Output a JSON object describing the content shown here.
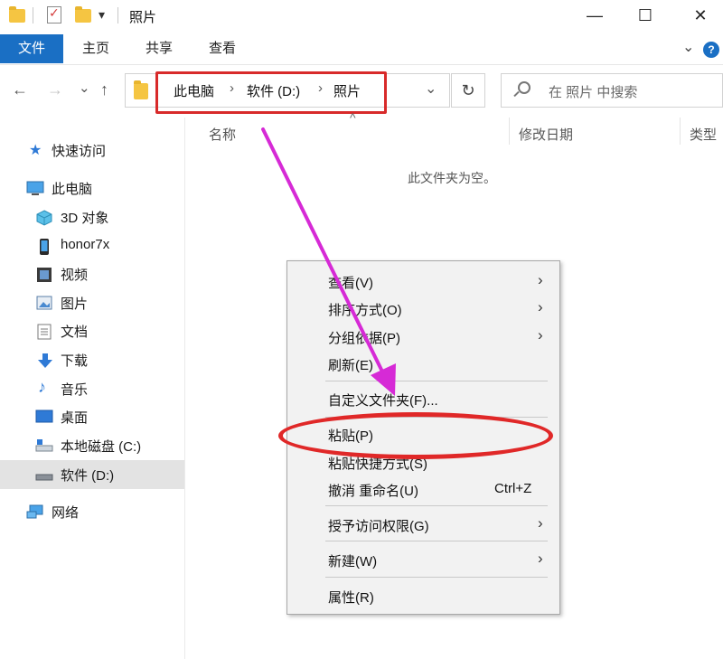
{
  "window": {
    "title": "照片",
    "qat_dropdown": "▾",
    "minimize": "—",
    "maximize": "☐",
    "close": "✕"
  },
  "ribbon": {
    "tabs": [
      "文件",
      "主页",
      "共享",
      "查看"
    ],
    "expand": "⌄",
    "help": "?"
  },
  "nav": {
    "back": "←",
    "forward": "→",
    "recent": "⌄",
    "up": "↑",
    "breadcrumb": [
      "此电脑",
      "软件 (D:)",
      "照片"
    ],
    "crumb_separator": "›",
    "dropdown": "⌄",
    "refresh": "↻",
    "search_placeholder": "在 照片 中搜索"
  },
  "sidebar": {
    "items": [
      {
        "label": "快速访问",
        "icon": "star-icon"
      },
      {
        "label": "此电脑",
        "icon": "computer-icon"
      },
      {
        "label": "3D 对象",
        "icon": "cube-icon"
      },
      {
        "label": "honor7x",
        "icon": "phone-icon"
      },
      {
        "label": "视频",
        "icon": "film-icon"
      },
      {
        "label": "图片",
        "icon": "picture-icon"
      },
      {
        "label": "文档",
        "icon": "document-icon"
      },
      {
        "label": "下载",
        "icon": "download-icon"
      },
      {
        "label": "音乐",
        "icon": "music-icon"
      },
      {
        "label": "桌面",
        "icon": "desktop-icon"
      },
      {
        "label": "本地磁盘 (C:)",
        "icon": "drive-icon"
      },
      {
        "label": "软件 (D:)",
        "icon": "drive-icon"
      },
      {
        "label": "网络",
        "icon": "network-icon"
      }
    ],
    "selected": "软件 (D:)"
  },
  "content": {
    "columns": [
      "名称",
      "修改日期",
      "类型"
    ],
    "sort_indicator": "^",
    "empty_message": "此文件夹为空。"
  },
  "context_menu": {
    "items": [
      {
        "label": "查看(V)",
        "submenu": true
      },
      {
        "label": "排序方式(O)",
        "submenu": true
      },
      {
        "label": "分组依据(P)",
        "submenu": true
      },
      {
        "label": "刷新(E)",
        "submenu": false
      },
      {
        "label": "自定义文件夹(F)...",
        "submenu": false
      },
      {
        "label": "粘贴(P)",
        "submenu": false
      },
      {
        "label": "粘贴快捷方式(S)",
        "submenu": false
      },
      {
        "label": "撤消 重命名(U)",
        "submenu": false,
        "shortcut": "Ctrl+Z"
      },
      {
        "label": "授予访问权限(G)",
        "submenu": true
      },
      {
        "label": "新建(W)",
        "submenu": true
      },
      {
        "label": "属性(R)",
        "submenu": false
      }
    ],
    "submenu_arrow": "›"
  },
  "annotation_colors": {
    "highlight_red": "#d82a2a",
    "arrow_magenta": "#d62ad6",
    "accent_blue": "#1a6fc4"
  }
}
